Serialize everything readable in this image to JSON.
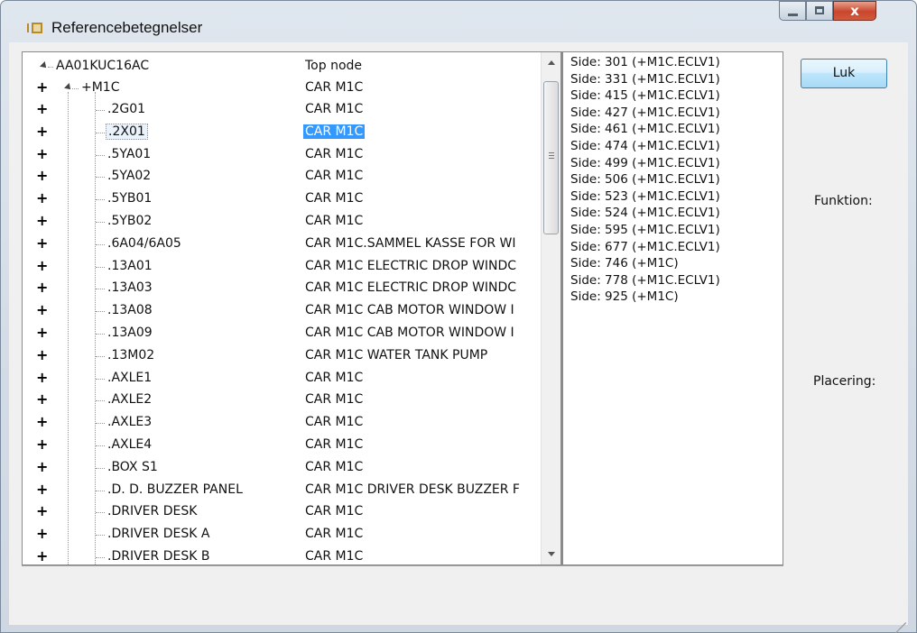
{
  "window": {
    "title": "Referencebetegnelser",
    "close_glyph": "x"
  },
  "tree": {
    "root": {
      "label": "AA01KUC16AC",
      "desc": "Top node"
    },
    "child": {
      "label": "+M1C",
      "desc": "CAR M1C"
    },
    "items": [
      {
        "label": ".2G01",
        "desc": "CAR M1C"
      },
      {
        "label": ".2X01",
        "desc": "CAR M1C",
        "selected": true
      },
      {
        "label": ".5YA01",
        "desc": "CAR M1C"
      },
      {
        "label": ".5YA02",
        "desc": "CAR M1C"
      },
      {
        "label": ".5YB01",
        "desc": "CAR M1C"
      },
      {
        "label": ".5YB02",
        "desc": "CAR M1C"
      },
      {
        "label": ".6A04/6A05",
        "desc": "CAR M1C.SAMMEL KASSE FOR WI"
      },
      {
        "label": ".13A01",
        "desc": "CAR M1C ELECTRIC DROP WINDC"
      },
      {
        "label": ".13A03",
        "desc": "CAR M1C ELECTRIC DROP WINDC"
      },
      {
        "label": ".13A08",
        "desc": "CAR M1C CAB MOTOR WINDOW I"
      },
      {
        "label": ".13A09",
        "desc": "CAR M1C CAB MOTOR WINDOW I"
      },
      {
        "label": ".13M02",
        "desc": "CAR M1C WATER TANK PUMP"
      },
      {
        "label": ".AXLE1",
        "desc": "CAR M1C"
      },
      {
        "label": ".AXLE2",
        "desc": "CAR M1C"
      },
      {
        "label": ".AXLE3",
        "desc": "CAR M1C"
      },
      {
        "label": ".AXLE4",
        "desc": "CAR M1C"
      },
      {
        "label": ".BOX S1",
        "desc": "CAR M1C"
      },
      {
        "label": ".D. D. BUZZER PANEL",
        "desc": "CAR M1C DRIVER DESK BUZZER F"
      },
      {
        "label": ".DRIVER DESK",
        "desc": "CAR M1C"
      },
      {
        "label": ".DRIVER DESK A",
        "desc": "CAR M1C"
      },
      {
        "label": ".DRIVER DESK B",
        "desc": "CAR M1C"
      }
    ],
    "expand_glyph": "+"
  },
  "sides": [
    "Side: 301 (+M1C.ECLV1)",
    "Side: 331 (+M1C.ECLV1)",
    "Side: 415 (+M1C.ECLV1)",
    "Side: 427 (+M1C.ECLV1)",
    "Side: 461 (+M1C.ECLV1)",
    "Side: 474 (+M1C.ECLV1)",
    "Side: 499 (+M1C.ECLV1)",
    "Side: 506 (+M1C.ECLV1)",
    "Side: 523 (+M1C.ECLV1)",
    "Side: 524 (+M1C.ECLV1)",
    "Side: 595 (+M1C.ECLV1)",
    "Side: 677 (+M1C.ECLV1)",
    "Side: 746 (+M1C)",
    "Side: 778 (+M1C.ECLV1)",
    "Side: 925 (+M1C)"
  ],
  "buttons": {
    "close_label": "Luk"
  },
  "labels": {
    "funktion": "Funktion:",
    "placering": "Placering:"
  },
  "colors": {
    "selection": "#3399ff",
    "button_border": "#3c7fb1"
  }
}
